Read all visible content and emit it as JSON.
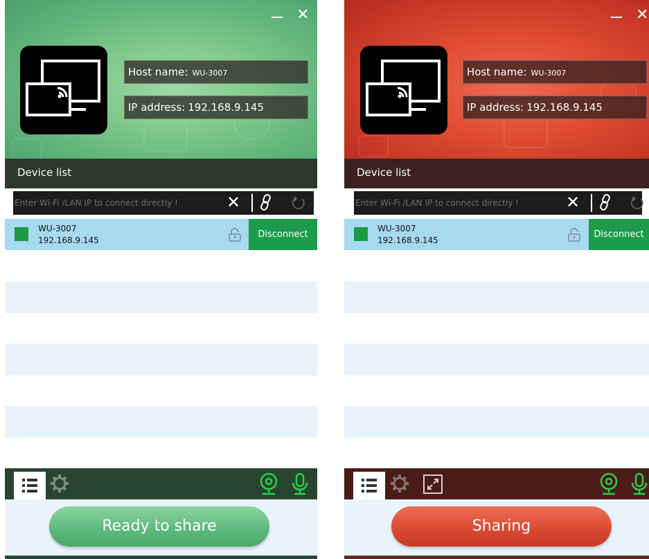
{
  "window_controls": {
    "minimize": "—",
    "close": "✕"
  },
  "host_label": "Host name:",
  "host_value": "WU-3007",
  "ip_label": "IP address:",
  "ip_value": "192.168.9.145",
  "device_list_label": "Device list",
  "ip_input_placeholder": "Enter Wi-Fi /LAN IP to connect directly !",
  "device": {
    "name": "WU-3007",
    "ip": "192.168.9.145"
  },
  "disconnect_label": "Disconnect",
  "green_panel": {
    "share_label": "Ready to share",
    "accent": "#5fb27a"
  },
  "red_panel": {
    "share_label": "Sharing",
    "accent": "#dc4a33"
  },
  "icons": [
    "cast-screen-icon",
    "clear-icon",
    "link-icon",
    "refresh-icon",
    "lock-icon",
    "list-icon",
    "gear-icon",
    "fullscreen-toggle-icon",
    "camera-icon",
    "microphone-icon"
  ]
}
